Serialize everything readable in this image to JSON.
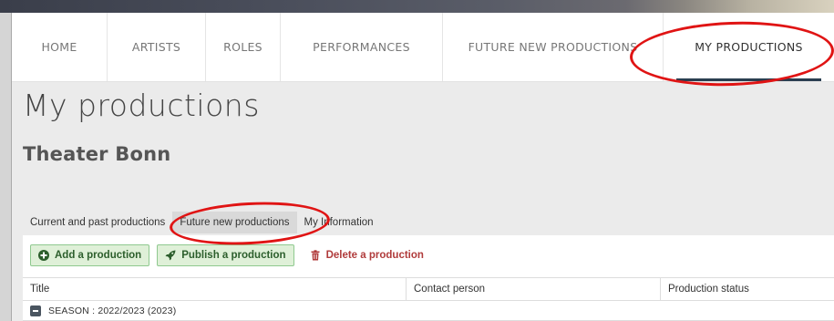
{
  "nav": {
    "items": [
      {
        "label": "HOME",
        "active": false
      },
      {
        "label": "ARTISTS",
        "active": false
      },
      {
        "label": "ROLES",
        "active": false
      },
      {
        "label": "PERFORMANCES",
        "active": false
      },
      {
        "label": "FUTURE NEW PRODUCTIONS",
        "active": false
      },
      {
        "label": "MY PRODUCTIONS",
        "active": true
      }
    ]
  },
  "page": {
    "title": "My productions",
    "subtitle": "Theater Bonn"
  },
  "tabs": [
    {
      "label": "Current and past productions",
      "active": false
    },
    {
      "label": "Future new productions",
      "active": true
    },
    {
      "label": "My Information",
      "active": false
    }
  ],
  "toolbar": {
    "add_label": "Add a production",
    "add_icon": "plus-circle-icon",
    "publish_label": "Publish a production",
    "publish_icon": "rocket-icon",
    "delete_label": "Delete a production",
    "delete_icon": "trash-icon"
  },
  "table": {
    "columns": [
      "Title",
      "Contact person",
      "Production status"
    ],
    "groups": [
      {
        "label": "SEASON : 2022/2023 (2023)",
        "icon": "collapse-minus-icon"
      }
    ]
  },
  "colors": {
    "annotation": "#e01414",
    "active_underline": "#2a3e50",
    "button_green_bg": "#dff0d8",
    "delete_red": "#b03b3b"
  }
}
